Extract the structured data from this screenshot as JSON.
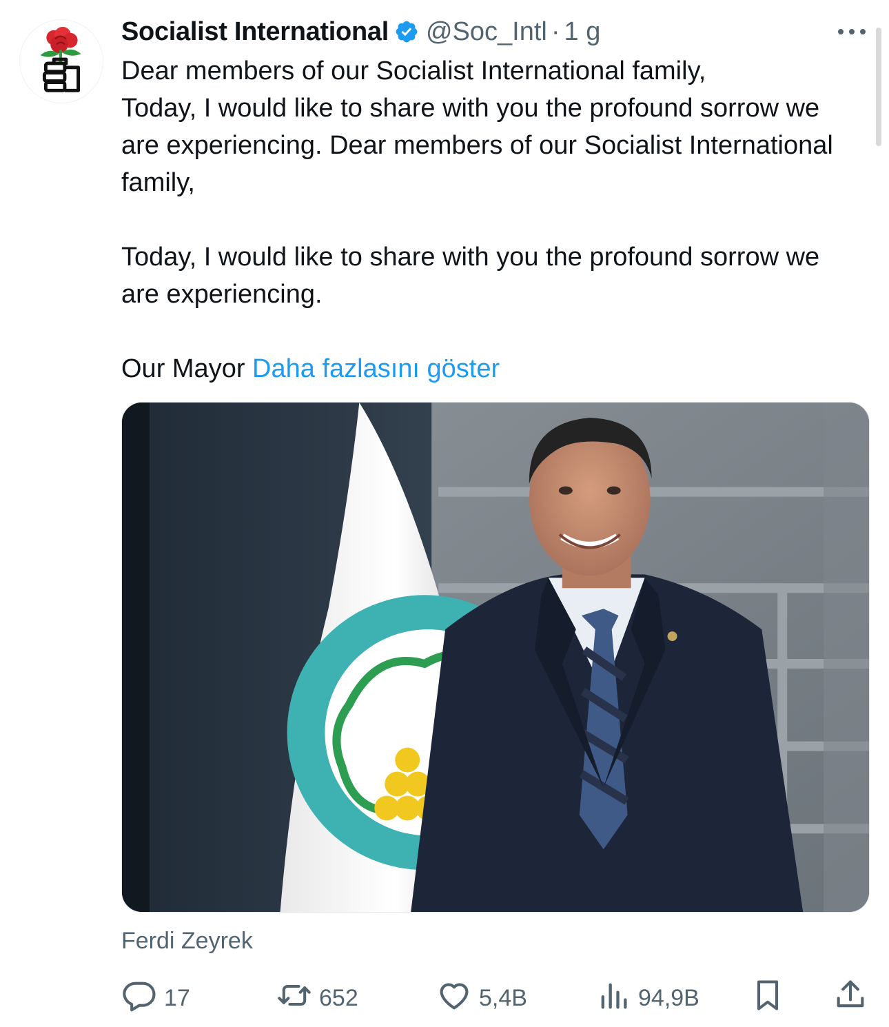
{
  "post": {
    "author_name": "Socialist International",
    "handle": "@Soc_Intl",
    "separator": "·",
    "time_ago": "1 g",
    "paragraphs": [
      "Dear members of our Socialist International family,\nToday, I would like to share with you the profound sorrow we are experiencing.  Dear members of our Socialist International family,",
      "Today, I would like to share with you the profound sorrow we are experiencing."
    ],
    "last_line_prefix": "Our Mayor ",
    "show_more_label": "Daha fazlasını göster",
    "image_caption": "Ferdi Zeyrek"
  },
  "stats": {
    "replies": "17",
    "reposts": "652",
    "likes": "5,4B",
    "views": "94,9B"
  },
  "icons": {
    "verified": "verified-badge-icon",
    "more": "more-options-icon",
    "reply": "reply-icon",
    "repost": "repost-icon",
    "like": "heart-icon",
    "views": "views-chart-icon",
    "bookmark": "bookmark-icon",
    "share": "share-icon"
  },
  "colors": {
    "link": "#1d9bf0",
    "muted": "#536471",
    "text": "#0f1419",
    "verified": "#1d9bf0"
  }
}
